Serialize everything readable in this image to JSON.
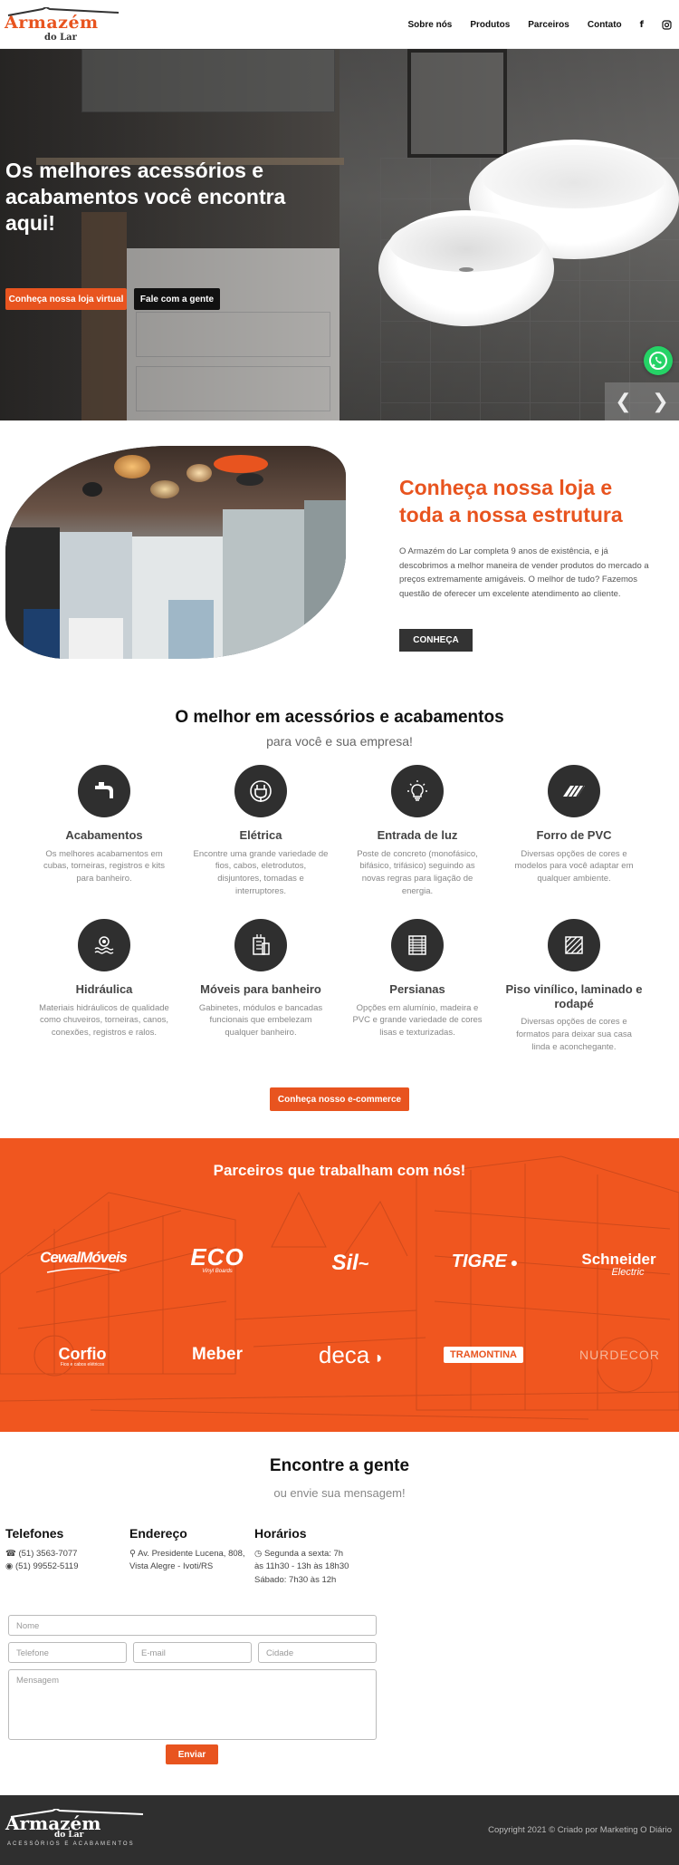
{
  "brand": {
    "name_line1": "Armazém",
    "name_line2": "do Lar",
    "tagline": "ACESSÓRIOS E ACABAMENTOS",
    "accent": "#e8541f",
    "dark": "#2f2f2f"
  },
  "nav": {
    "items": [
      "Sobre nós",
      "Produtos",
      "Parceiros",
      "Contato"
    ],
    "facebook_icon": "facebook-icon",
    "instagram_icon": "instagram-icon"
  },
  "hero": {
    "title": "Os melhores acessórios e acabamentos você encontra aqui!",
    "primary_button": "Conheça nossa loja virtual",
    "secondary_button": "Fale com a gente",
    "prev_arrow": "❮",
    "next_arrow": "❯"
  },
  "about": {
    "title": "Conheça nossa loja e toda a nossa estrutura",
    "text": "O Armazém do Lar completa 9 anos de existência, e já descobrimos a melhor maneira de vender produtos do mercado a preços extremamente amigáveis. O melhor de tudo? Fazemos questão de oferecer um excelente atendimento ao cliente.",
    "button": "CONHEÇA"
  },
  "features": {
    "title": "O melhor em acessórios e acabamentos",
    "subtitle": "para você e sua empresa!",
    "items": [
      {
        "title": "Acabamentos",
        "desc": "Os melhores acabamentos em cubas, torneiras, registros e kits para banheiro.",
        "icon": "faucet-icon"
      },
      {
        "title": "Elétrica",
        "desc": "Encontre uma grande variedade de fios, cabos, eletrodutos, disjuntores, tomadas e interruptores.",
        "icon": "plug-icon"
      },
      {
        "title": "Entrada de luz",
        "desc": "Poste de concreto (monofásico, bifásico, trifásico) seguindo as novas regras para ligação de energia.",
        "icon": "lightbulb-icon"
      },
      {
        "title": "Forro de PVC",
        "desc": "Diversas opções de cores e modelos para você adaptar em qualquer ambiente.",
        "icon": "pvc-panel-icon"
      },
      {
        "title": "Hidráulica",
        "desc": "Materiais hidráulicos de qualidade como chuveiros, torneiras, canos, conexões, registros e ralos.",
        "icon": "water-valve-icon"
      },
      {
        "title": "Móveis para banheiro",
        "desc": "Gabinetes, módulos e bancadas funcionais que embelezam qualquer banheiro.",
        "icon": "cabinet-icon"
      },
      {
        "title": "Persianas",
        "desc": "Opções em alumínio, madeira e PVC e grande variedade de cores lisas e texturizadas.",
        "icon": "blinds-icon"
      },
      {
        "title": "Piso vinílico, laminado e rodapé",
        "desc": "Diversas opções de cores e formatos para deixar sua casa linda e aconchegante.",
        "icon": "floor-icon"
      }
    ],
    "button": "Conheça nosso e-commerce"
  },
  "partners": {
    "title": "Parceiros que trabalham com nós!",
    "logos": [
      "CewalMóveis",
      "ECO",
      "Sil",
      "TIGRE",
      "Schneider",
      "Corfio",
      "Meber",
      "deca",
      "TRAMONTINA",
      "NURDECOR"
    ],
    "schneider_sub": "Electric",
    "corfio_sub": "Fios e cabos elétricos",
    "eco_sub": "Vinyl Boards"
  },
  "contact": {
    "title": "Encontre a gente",
    "subtitle": "ou envie sua mensagem!",
    "phones_title": "Telefones",
    "phone": "(51) 3563-7077",
    "whatsapp": "(51) 99552-5119",
    "address_title": "Endereço",
    "address": "Av. Presidente Lucena, 808, Vista Alegre - Ivoti/RS",
    "hours_title": "Horários",
    "hours_week": "Segunda a sexta: 7h às 11h30 - 13h às 18h30",
    "hours_sat": "Sábado: 7h30 às 12h",
    "form": {
      "name": "Nome",
      "phone": "Telefone",
      "email": "E-mail",
      "city": "Cidade",
      "message": "Mensagem",
      "submit": "Enviar"
    }
  },
  "footer": {
    "copyright": "Copyright 2021 © Criado por Marketing O Diário"
  }
}
